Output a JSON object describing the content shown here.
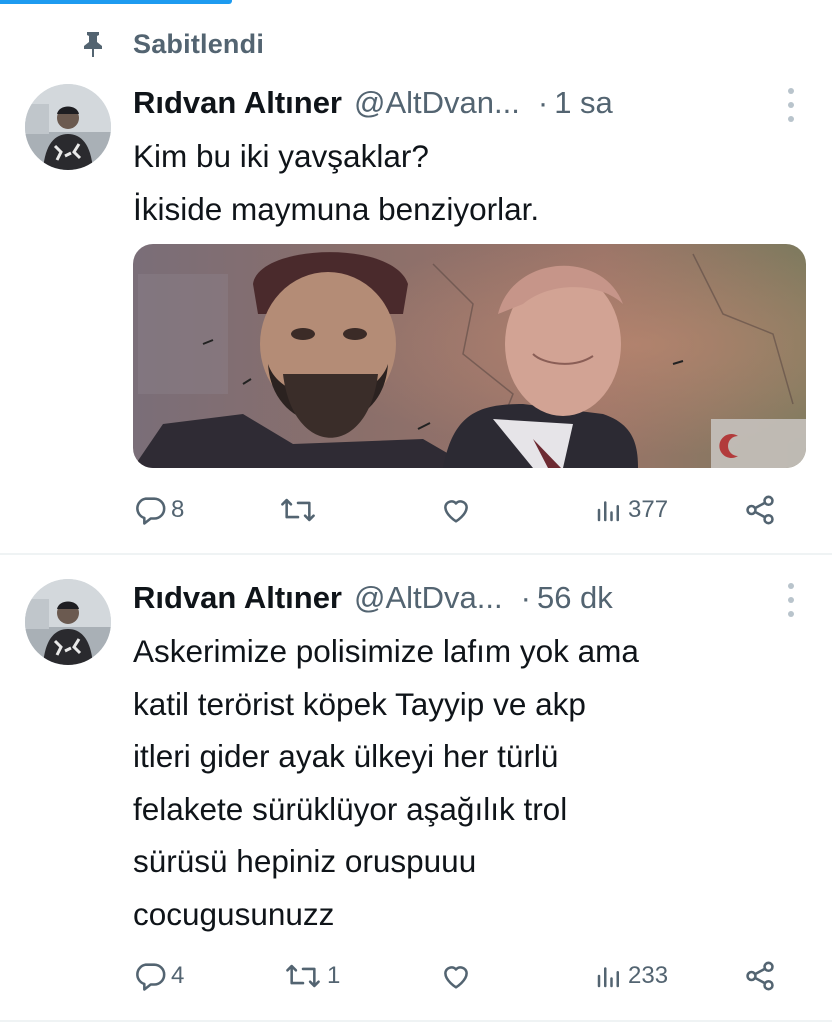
{
  "pinned": {
    "label": "Sabitlendi",
    "icon": "pin-icon"
  },
  "tweets": [
    {
      "name": "Rıdvan Altıner",
      "handle": "@AltDvan...",
      "dot": "·",
      "time": "1 sa",
      "lines": [
        "Kim bu iki yavşaklar?",
        "İkiside maymuna benziyorlar."
      ],
      "counts": {
        "replies": "8",
        "retweets": "",
        "likes": "",
        "views": "377"
      }
    },
    {
      "name": "Rıdvan Altıner",
      "handle": "@AltDva...",
      "dot": "·",
      "time": "56 dk",
      "lines": [
        "Askerimize polisimize lafım yok ama",
        "katil terörist köpek Tayyip ve akp",
        "itleri gider ayak ülkeyi her türlü",
        "felakete sürüklüyor aşağılık trol",
        "sürüsü hepiniz oruspuuu",
        "cocugusunuzz"
      ],
      "counts": {
        "replies": "4",
        "retweets": "1",
        "likes": "",
        "views": "233"
      }
    }
  ],
  "colors": {
    "accent": "#1d9bf0",
    "secondary_text": "#536471",
    "divider": "#eff3f4"
  },
  "icons": [
    "pin-icon",
    "more-icon",
    "reply-icon",
    "retweet-icon",
    "like-icon",
    "views-icon",
    "share-icon"
  ]
}
